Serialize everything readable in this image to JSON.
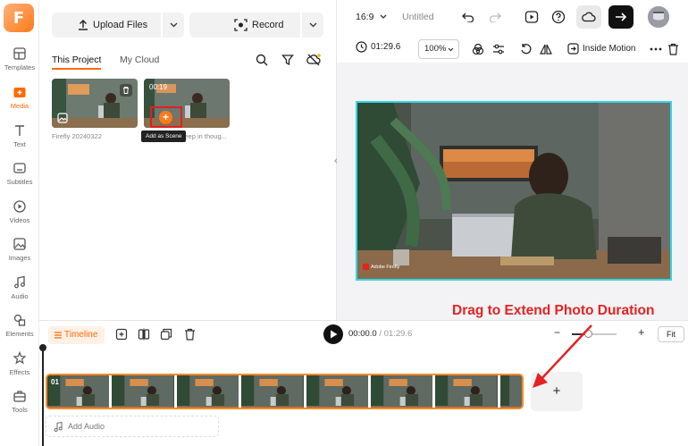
{
  "app": {
    "logo_letter": "F",
    "brand_color": "#ff6a00"
  },
  "nav": {
    "items": [
      {
        "label": "Templates",
        "icon": "templates-icon"
      },
      {
        "label": "Media",
        "icon": "media-icon",
        "active": true
      },
      {
        "label": "Text",
        "icon": "text-icon"
      },
      {
        "label": "Subtitles",
        "icon": "subtitles-icon"
      },
      {
        "label": "Videos",
        "icon": "videos-icon"
      },
      {
        "label": "Images",
        "icon": "images-icon"
      },
      {
        "label": "Audio",
        "icon": "audio-icon"
      },
      {
        "label": "Elements",
        "icon": "elements-icon"
      },
      {
        "label": "Effects",
        "icon": "effects-icon"
      },
      {
        "label": "Tools",
        "icon": "tools-icon"
      }
    ]
  },
  "media": {
    "upload_label": "Upload Files",
    "record_label": "Record",
    "tabs": {
      "project": "This Project",
      "cloud": "My Cloud"
    },
    "items": [
      {
        "caption": "Firefly 20240322",
        "duration": ""
      },
      {
        "caption": "Journalist deep in thoug...",
        "duration": "00:19"
      }
    ],
    "add_scene_tooltip": "Add as Scene",
    "add_symbol": "+"
  },
  "topbar": {
    "ratio": "16:9",
    "title": "Untitled",
    "export_icon": "arrow-right-icon"
  },
  "preview_toolbar": {
    "duration": "01:29.6",
    "zoom": "100%",
    "inside_motion": "Inside Motion"
  },
  "preview": {
    "watermark": "Adobe Firefly"
  },
  "timeline": {
    "label": "Timeline",
    "current_time": "00:00.0",
    "separator": "/",
    "total_time": "01:29.6",
    "zoom_minus": "−",
    "zoom_plus": "+",
    "zoom_level": 0.35,
    "fit_label": "Fit",
    "clip_number": "01",
    "add_clip_symbol": "+",
    "add_audio_label": "Add Audio"
  },
  "annotation": {
    "text": "Drag to Extend Photo Duration",
    "color": "#e42222"
  }
}
